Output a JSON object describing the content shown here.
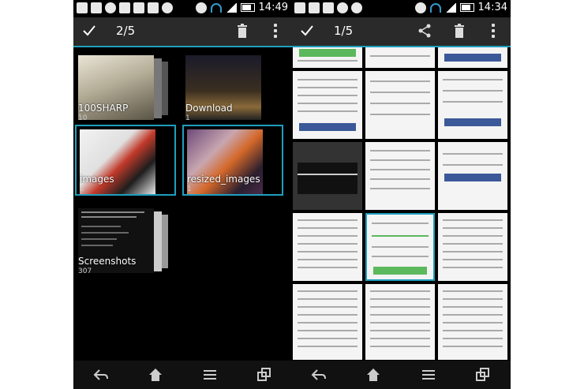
{
  "left": {
    "status": {
      "time": "14:49"
    },
    "actionbar": {
      "count": "2/5"
    },
    "albums": [
      {
        "name": "100SHARP",
        "count": "10",
        "selected": false
      },
      {
        "name": "Download",
        "count": "1",
        "selected": false
      },
      {
        "name": "images",
        "count": "1",
        "selected": true
      },
      {
        "name": "resized_images",
        "count": "1",
        "selected": true
      },
      {
        "name": "Screenshots",
        "count": "307",
        "selected": false
      }
    ]
  },
  "right": {
    "status": {
      "time": "14:34"
    },
    "actionbar": {
      "count": "1/5"
    }
  },
  "colors": {
    "accent": "#1e9fc0",
    "actionbar": "#2a2a2a",
    "background": "#000000"
  }
}
